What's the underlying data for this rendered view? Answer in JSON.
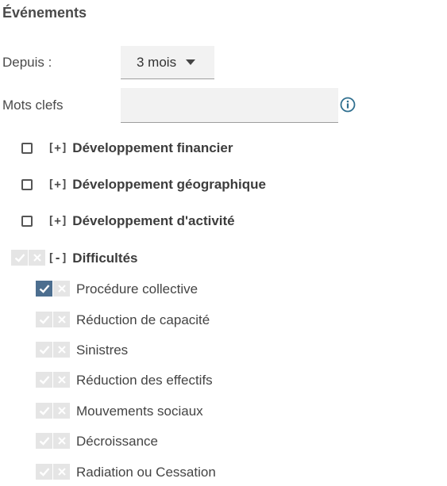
{
  "section": {
    "title": "Événements"
  },
  "period": {
    "label": "Depuis :",
    "value": "3 mois"
  },
  "keywords": {
    "label": "Mots clefs",
    "value": "",
    "placeholder": ""
  },
  "categories": [
    {
      "expander": "[+]",
      "label": "Développement financier",
      "checked": false
    },
    {
      "expander": "[+]",
      "label": "Développement géographique",
      "checked": false
    },
    {
      "expander": "[+]",
      "label": "Développement d'activité",
      "checked": false
    },
    {
      "expander": "[-]",
      "label": "Difficultés",
      "state": "neutral"
    }
  ],
  "subitems": [
    {
      "label": "Procédure collective",
      "state": "checked"
    },
    {
      "label": "Réduction de capacité",
      "state": "neutral"
    },
    {
      "label": "Sinistres",
      "state": "neutral"
    },
    {
      "label": "Réduction des effectifs",
      "state": "neutral"
    },
    {
      "label": "Mouvements sociaux",
      "state": "neutral"
    },
    {
      "label": "Décroissance",
      "state": "neutral"
    },
    {
      "label": "Radiation ou Cessation",
      "state": "neutral"
    }
  ],
  "colors": {
    "accent": "#4c6e8f",
    "inactive": "#e5e5e5"
  }
}
